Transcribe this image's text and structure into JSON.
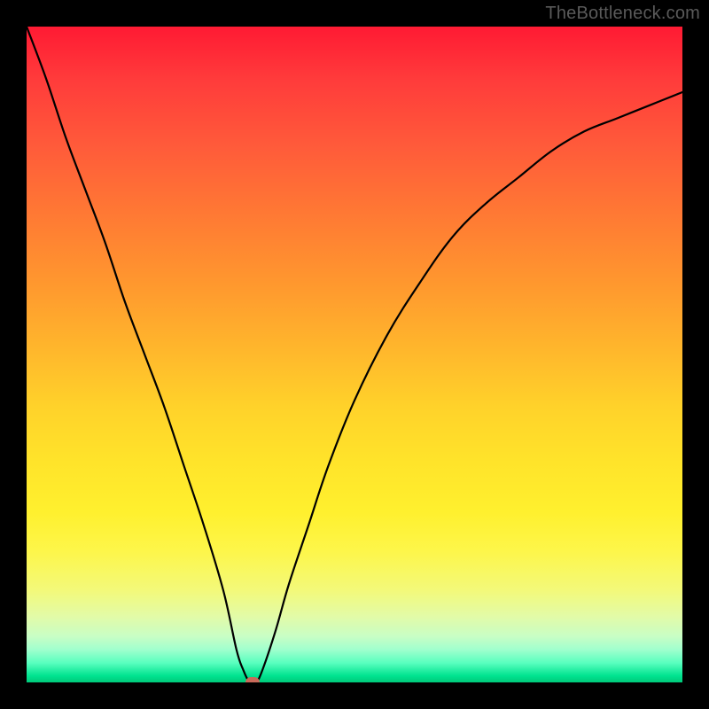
{
  "watermark": {
    "text": "TheBottleneck.com"
  },
  "colors": {
    "frame": "#000000",
    "curve": "#000000",
    "marker": "#c96a5a",
    "watermark": "#5a5a5a"
  },
  "chart_data": {
    "type": "line",
    "title": "",
    "xlabel": "",
    "ylabel": "",
    "xlim": [
      0,
      100
    ],
    "ylim": [
      0,
      100
    ],
    "grid": false,
    "legend": false,
    "series": [
      {
        "name": "bottleneck-curve",
        "x": [
          0,
          3,
          6,
          9,
          12,
          15,
          18,
          21,
          24,
          27,
          30,
          32,
          33,
          34,
          35,
          36,
          38,
          40,
          43,
          46,
          50,
          55,
          60,
          65,
          70,
          75,
          80,
          85,
          90,
          95,
          100
        ],
        "values": [
          100,
          92,
          83,
          75,
          67,
          58,
          50,
          42,
          33,
          24,
          14,
          5,
          2,
          0,
          0,
          2,
          8,
          15,
          24,
          33,
          43,
          53,
          61,
          68,
          73,
          77,
          81,
          84,
          86,
          88,
          90
        ]
      }
    ],
    "marker": {
      "x": 34.5,
      "y": 0
    },
    "gradient_stops": [
      {
        "pct": 0,
        "hex": "#ff1a33"
      },
      {
        "pct": 8,
        "hex": "#ff3b3b"
      },
      {
        "pct": 18,
        "hex": "#ff5a3a"
      },
      {
        "pct": 30,
        "hex": "#ff7d33"
      },
      {
        "pct": 40,
        "hex": "#ff9a2e"
      },
      {
        "pct": 50,
        "hex": "#ffb92c"
      },
      {
        "pct": 58,
        "hex": "#ffd22a"
      },
      {
        "pct": 66,
        "hex": "#ffe32a"
      },
      {
        "pct": 74,
        "hex": "#fff02e"
      },
      {
        "pct": 80,
        "hex": "#fdf64a"
      },
      {
        "pct": 86,
        "hex": "#f3f97a"
      },
      {
        "pct": 90,
        "hex": "#e2fba8"
      },
      {
        "pct": 93,
        "hex": "#c8fec5"
      },
      {
        "pct": 95,
        "hex": "#a0ffce"
      },
      {
        "pct": 97,
        "hex": "#5affbf"
      },
      {
        "pct": 99,
        "hex": "#00e38f"
      },
      {
        "pct": 100,
        "hex": "#00c97a"
      }
    ]
  }
}
